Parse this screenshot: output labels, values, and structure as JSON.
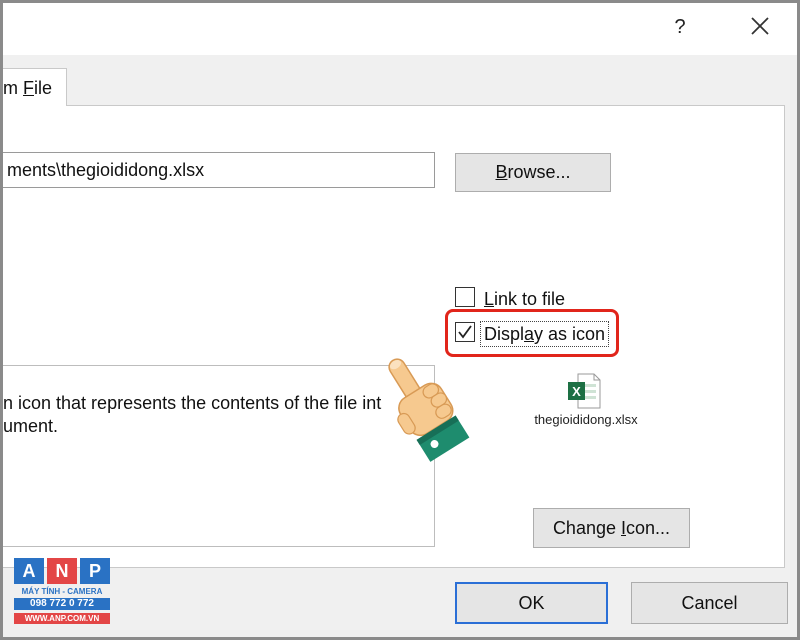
{
  "title_bar": {
    "help_label": "?"
  },
  "tab": {
    "label_pre": "m ",
    "label_ul": "F",
    "label_post": "ile"
  },
  "file": {
    "path_value": "ments\\thegioididong.xlsx"
  },
  "buttons": {
    "browse": {
      "pre": "",
      "ul": "B",
      "post": "rowse..."
    },
    "change_icon": {
      "pre": "Change ",
      "ul": "I",
      "post": "con..."
    },
    "ok": "OK",
    "cancel": "Cancel"
  },
  "options": {
    "link_to_file": {
      "pre": "",
      "ul": "L",
      "post": "ink to file",
      "checked": false
    },
    "display_as_icon": {
      "pre": "Displ",
      "ul": "a",
      "post": "y as icon",
      "checked": true
    }
  },
  "result": {
    "line1": "n icon that represents the contents of the file int",
    "line2": "ument."
  },
  "icon_preview": {
    "caption": "thegioididong.xlsx",
    "icon": "excel-file-icon"
  },
  "watermark": {
    "letters": [
      "A",
      "N",
      "P"
    ],
    "tagline": "MÁY TÍNH - CAMERA",
    "phone": "098 772 0 772",
    "website": "WWW.ANP.COM.VN"
  },
  "colors": {
    "highlight": "#e1251b",
    "ok_border": "#2b6fd6",
    "logo_blue": "#2a72c4",
    "logo_red": "#e34646",
    "excel_green": "#1d7044"
  }
}
